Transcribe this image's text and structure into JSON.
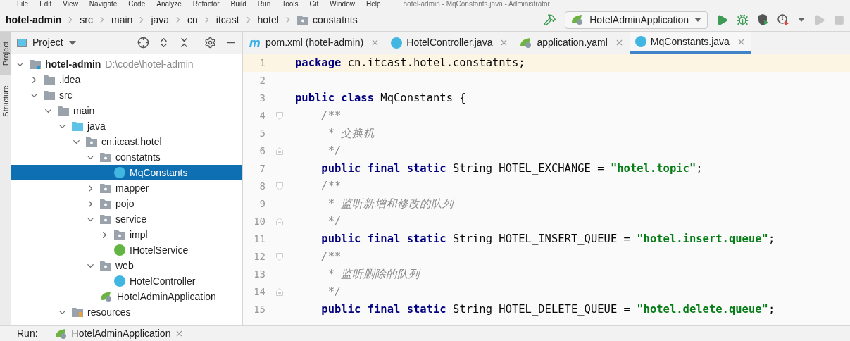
{
  "menu": [
    "File",
    "Edit",
    "View",
    "Navigate",
    "Code",
    "Analyze",
    "Refactor",
    "Build",
    "Run",
    "Tools",
    "Git",
    "Window",
    "Help"
  ],
  "window": {
    "title": "hotel-admin - MqConstants.java - Administrator"
  },
  "breadcrumbs": [
    {
      "label": "hotel-admin",
      "kind": "module"
    },
    {
      "label": "src",
      "kind": "plain"
    },
    {
      "label": "main",
      "kind": "plain"
    },
    {
      "label": "java",
      "kind": "plain"
    },
    {
      "label": "cn",
      "kind": "plain"
    },
    {
      "label": "itcast",
      "kind": "plain"
    },
    {
      "label": "hotel",
      "kind": "plain"
    },
    {
      "label": "constatnts",
      "kind": "package"
    }
  ],
  "run_config": {
    "label": "HotelAdminApplication"
  },
  "side_tabs": [
    {
      "label": "Project",
      "selected": true
    },
    {
      "label": "Structure",
      "selected": false
    }
  ],
  "project_panel": {
    "title": "Project",
    "tree": [
      {
        "label": "hotel-admin",
        "path": "D:\\code\\hotel-admin",
        "kind": "module",
        "expanded": true,
        "selected": false,
        "children": [
          {
            "label": ".idea",
            "kind": "folder",
            "expanded": false,
            "selected": false
          },
          {
            "label": "src",
            "kind": "folder",
            "expanded": true,
            "selected": false,
            "children": [
              {
                "label": "main",
                "kind": "folder",
                "expanded": true,
                "selected": false,
                "children": [
                  {
                    "label": "java",
                    "kind": "source",
                    "expanded": true,
                    "selected": false,
                    "children": [
                      {
                        "label": "cn.itcast.hotel",
                        "kind": "package",
                        "expanded": true,
                        "selected": false,
                        "children": [
                          {
                            "label": "constatnts",
                            "kind": "package",
                            "expanded": true,
                            "selected": false,
                            "children": [
                              {
                                "label": "MqConstants",
                                "kind": "class",
                                "selected": true
                              }
                            ]
                          },
                          {
                            "label": "mapper",
                            "kind": "package",
                            "expanded": false,
                            "selected": false
                          },
                          {
                            "label": "pojo",
                            "kind": "package",
                            "expanded": false,
                            "selected": false
                          },
                          {
                            "label": "service",
                            "kind": "package",
                            "expanded": true,
                            "selected": false,
                            "children": [
                              {
                                "label": "impl",
                                "kind": "package",
                                "expanded": false,
                                "selected": false
                              },
                              {
                                "label": "IHotelService",
                                "kind": "interface",
                                "selected": false
                              }
                            ]
                          },
                          {
                            "label": "web",
                            "kind": "package",
                            "expanded": true,
                            "selected": false,
                            "children": [
                              {
                                "label": "HotelController",
                                "kind": "class",
                                "selected": false
                              }
                            ]
                          },
                          {
                            "label": "HotelAdminApplication",
                            "kind": "spring",
                            "selected": false
                          }
                        ]
                      }
                    ]
                  },
                  {
                    "label": "resources",
                    "kind": "resources",
                    "expanded": true,
                    "selected": false
                  }
                ]
              }
            ]
          }
        ]
      }
    ]
  },
  "tabs": [
    {
      "label": "pom.xml (hotel-admin)",
      "kind": "maven",
      "selected": false
    },
    {
      "label": "HotelController.java",
      "kind": "class",
      "selected": false
    },
    {
      "label": "application.yaml",
      "kind": "spring",
      "selected": false
    },
    {
      "label": "MqConstants.java",
      "kind": "file",
      "selected": true
    }
  ],
  "code": [
    {
      "number": "1",
      "kind": "plain",
      "current": true,
      "tokens": [
        {
          "kind": "keyword",
          "text": "package"
        },
        {
          "kind": "plain",
          "text": " cn.itcast.hotel.constatnts;"
        }
      ]
    },
    {
      "number": "2",
      "kind": "plain",
      "current": false
    },
    {
      "number": "3",
      "kind": "plain",
      "current": false,
      "tokens": [
        {
          "kind": "keyword",
          "text": "public class"
        },
        {
          "kind": "plain",
          "text": " MqConstants {"
        }
      ]
    },
    {
      "number": "4",
      "kind": "fold-start",
      "current": false,
      "tokens": [
        {
          "kind": "comment",
          "text": "    /**"
        }
      ]
    },
    {
      "number": "5",
      "kind": "plain",
      "current": false,
      "tokens": [
        {
          "kind": "comment",
          "text": "     * 交换机"
        }
      ]
    },
    {
      "number": "6",
      "kind": "fold-end",
      "current": false,
      "tokens": [
        {
          "kind": "comment",
          "text": "     */"
        }
      ]
    },
    {
      "number": "7",
      "kind": "plain",
      "current": false,
      "tokens": [
        {
          "kind": "keyword",
          "text": "    public final static"
        },
        {
          "kind": "plain",
          "text": " String HOTEL_EXCHANGE = "
        },
        {
          "kind": "string",
          "text": "\"hotel.topic\""
        },
        {
          "kind": "plain",
          "text": ";"
        }
      ]
    },
    {
      "number": "8",
      "kind": "fold-start",
      "current": false,
      "tokens": [
        {
          "kind": "comment",
          "text": "    /**"
        }
      ]
    },
    {
      "number": "9",
      "kind": "plain",
      "current": false,
      "tokens": [
        {
          "kind": "comment",
          "text": "     * 监听新增和修改的队列"
        }
      ]
    },
    {
      "number": "10",
      "kind": "fold-end",
      "current": false,
      "tokens": [
        {
          "kind": "comment",
          "text": "     */"
        }
      ]
    },
    {
      "number": "11",
      "kind": "plain",
      "current": false,
      "tokens": [
        {
          "kind": "keyword",
          "text": "    public final static"
        },
        {
          "kind": "plain",
          "text": " String HOTEL_INSERT_QUEUE = "
        },
        {
          "kind": "string",
          "text": "\"hotel.insert.queue\""
        },
        {
          "kind": "plain",
          "text": ";"
        }
      ]
    },
    {
      "number": "12",
      "kind": "fold-start",
      "current": false,
      "tokens": [
        {
          "kind": "comment",
          "text": "    /**"
        }
      ]
    },
    {
      "number": "13",
      "kind": "plain",
      "current": false,
      "tokens": [
        {
          "kind": "comment",
          "text": "     * 监听删除的队列"
        }
      ]
    },
    {
      "number": "14",
      "kind": "fold-end",
      "current": false,
      "tokens": [
        {
          "kind": "comment",
          "text": "     */"
        }
      ]
    },
    {
      "number": "15",
      "kind": "plain",
      "current": false,
      "tokens": [
        {
          "kind": "keyword",
          "text": "    public final static"
        },
        {
          "kind": "plain",
          "text": " String HOTEL_DELETE_QUEUE = "
        },
        {
          "kind": "string",
          "text": "\"hotel.delete.queue\""
        },
        {
          "kind": "plain",
          "text": ";"
        }
      ]
    }
  ],
  "run_bar": {
    "label": "Run:",
    "tab": "HotelAdminApplication"
  }
}
